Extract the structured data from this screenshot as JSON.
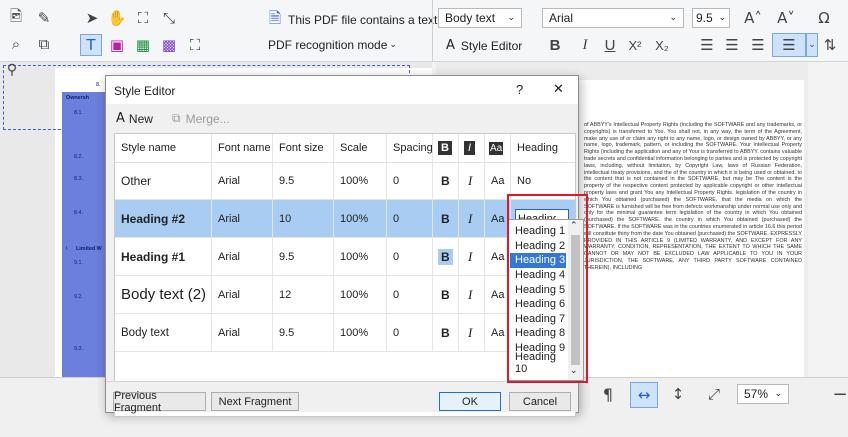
{
  "toolbar": {
    "pdf_status": "This PDF file contains a text layer",
    "recognition_mode": "PDF recognition mode",
    "style_select": "Body text",
    "font_select": "Arial",
    "font_size": "9.5",
    "style_editor_label": "Style Editor"
  },
  "dialog": {
    "title": "Style Editor",
    "help": "?",
    "close": "✕",
    "new_label": "New",
    "merge_label": "Merge...",
    "columns": [
      "Style name",
      "Font name",
      "Font size",
      "Scale",
      "Spacing",
      "B",
      "I",
      "Aa",
      "Heading"
    ],
    "rows": [
      {
        "name": "Other",
        "font": "Arial",
        "size": "9.5",
        "scale": "100%",
        "spacing": "0",
        "b": "B",
        "i": "I",
        "aa": "Aa",
        "heading": "No"
      },
      {
        "name": "Heading #2",
        "font": "Arial",
        "size": "10",
        "scale": "100%",
        "spacing": "0",
        "b": "B",
        "i": "I",
        "aa": "Aa",
        "heading": "Heading"
      },
      {
        "name": "Heading #1",
        "font": "Arial",
        "size": "9.5",
        "scale": "100%",
        "spacing": "0",
        "b": "B",
        "i": "I",
        "aa": "Aa",
        "heading": ""
      },
      {
        "name": "Body text (2)",
        "font": "Arial",
        "size": "12",
        "scale": "100%",
        "spacing": "0",
        "b": "B",
        "i": "I",
        "aa": "Aa",
        "heading": ""
      },
      {
        "name": "Body text",
        "font": "Arial",
        "size": "9.5",
        "scale": "100%",
        "spacing": "0",
        "b": "B",
        "i": "I",
        "aa": "Aa",
        "heading": ""
      }
    ],
    "buttons": {
      "prev": "Previous Fragment",
      "next": "Next Fragment",
      "ok": "OK",
      "cancel": "Cancel"
    }
  },
  "dropdown": {
    "items": [
      "Heading 1",
      "Heading 2",
      "Heading 3",
      "Heading 4",
      "Heading 5",
      "Heading 6",
      "Heading 7",
      "Heading 8",
      "Heading 9",
      "Heading 10"
    ],
    "selected_index": 2
  },
  "statusbar": {
    "zoom": "57%"
  },
  "document": {
    "left_labels": [
      "8.",
      "Ownersh",
      "8.1.",
      "8.2.",
      "8.3.",
      "8.4.",
      "9.",
      "Limited W",
      "9.1.",
      "9.2.",
      "9.3."
    ],
    "right_text": "of ABBYY's Intellectual Property Rights (including the SOFTWARE and any trademarks, or copyrights) is transferred to You. You shall not, in any way, the term of the Agreement, make any use of or claim any right to any name, logo, or design owned by ABBYY, or any name, logo, trademark, pattern, or including the SOFTWARE. Your Intellectual Property Rights (including the application and any of Your is transferred to ABBYY. contains valuable trade secrets and confidential information belonging to parties and is protected by copyright laws, including, without limitation, by Copyright Law, laws of Russian Federation, intellectual treaty provisions, and the of the country in which it is being used or obtained. to the content that is not contained in the SOFTWARE, but may be The content is the property of the respective content protected by applicable copyright or other intellectual property laws and grant You any Intellectual Property Rights. legislation of the country in which You obtained (purchased) the SOFTWARE, that the media on which the SOFTWARE is furnished will be free from defects workmanship under normal use only and only for the minimal guarantee term legislation of the country in which You obtained (purchased) the SOFTWARE. the country in which You obtained (purchased) the SOFTWARE. If the SOFTWARE was in the countries enumerated in article 16.6 this period will constitute thirty from the date You obtained (purchased) the SOFTWARE. EXPRESSLY PROVIDED IN THIS ARTICLE 9 (LIMITED WARRANTY, AND EXCEPT FOR ANY WARRANTY, CONDITION, REPRESENTATION, THE EXTENT TO WHICH THE SAME CANNOT OR MAY NOT BE EXCLUDED LAW APPLICABLE TO YOU IN YOUR JURISDICTION, THE SOFTWARE, ANY THIRD PARTY SOFTWARE CONTAINED THEREIN), INCLUDING"
  }
}
